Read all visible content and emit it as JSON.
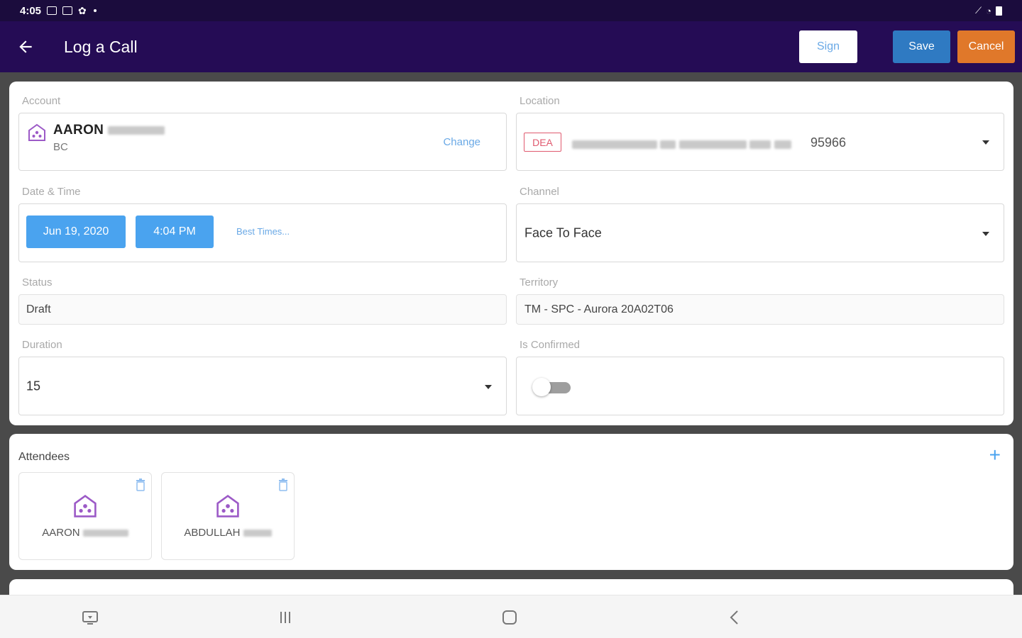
{
  "status_bar": {
    "time": "4:05"
  },
  "app_bar": {
    "title": "Log a Call",
    "sign_label": "Sign",
    "save_label": "Save",
    "cancel_label": "Cancel"
  },
  "account": {
    "label": "Account",
    "name": "AARON",
    "subtitle": "BC",
    "change_label": "Change"
  },
  "location": {
    "label": "Location",
    "badge": "DEA",
    "zip": "95966"
  },
  "datetime": {
    "label": "Date & Time",
    "date": "Jun 19, 2020",
    "time": "4:04 PM",
    "best_times_label": "Best Times..."
  },
  "channel": {
    "label": "Channel",
    "value": "Face To Face"
  },
  "status": {
    "label": "Status",
    "value": "Draft"
  },
  "territory": {
    "label": "Territory",
    "value": "TM - SPC - Aurora 20A02T06"
  },
  "duration": {
    "label": "Duration",
    "value": "15"
  },
  "is_confirmed": {
    "label": "Is Confirmed",
    "value": false
  },
  "attendees": {
    "title": "Attendees",
    "add_label": "+",
    "items": [
      {
        "name": "AARON"
      },
      {
        "name": "ABDULLAH"
      }
    ]
  },
  "colors": {
    "app_bar": "#250c55",
    "status_bar": "#1b0c3d",
    "save": "#2f7ac2",
    "cancel": "#e0782a",
    "accent": "#4aa3ef",
    "badge": "#e05a6f",
    "icon": "#9c5ac7"
  },
  "icons": [
    "back-arrow-icon",
    "account-icon",
    "chevron-down-icon",
    "plus-icon",
    "trash-icon",
    "recent-apps-icon",
    "home-icon",
    "back-icon"
  ]
}
